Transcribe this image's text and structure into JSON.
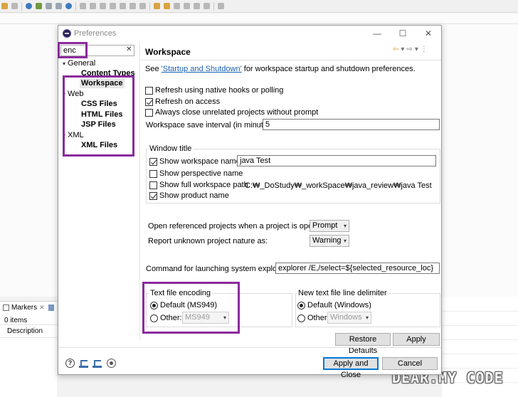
{
  "dialog": {
    "title": "Preferences",
    "minimize_glyph": "—",
    "maximize_glyph": "☐",
    "close_glyph": "✕"
  },
  "nav": {
    "search_value": "enc",
    "search_clear": "✕",
    "tree": {
      "general": "General",
      "content_types": "Content Types",
      "workspace": "Workspace",
      "web": "Web",
      "css_files": "CSS Files",
      "html_files": "HTML Files",
      "jsp_files": "JSP Files",
      "xml": "XML",
      "xml_files": "XML Files"
    }
  },
  "page": {
    "title": "Workspace",
    "desc_prefix": "See ",
    "desc_link": "'Startup and Shutdown'",
    "desc_suffix": " for workspace startup and shutdown preferences.",
    "refresh_native": "Refresh using native hooks or polling",
    "refresh_access": "Refresh on access",
    "always_close": "Always close unrelated projects without prompt",
    "save_interval_label": "Workspace save interval (in minutes):",
    "save_interval_value": "5",
    "window_title_group": "Window title",
    "show_ws_name": "Show workspace name:",
    "ws_name_value": "java Test",
    "show_perspective": "Show perspective name",
    "show_full_path": "Show full workspace path:",
    "full_path_value": "C:₩_DoStudy₩_workSpace₩java_review₩java Test",
    "show_product": "Show product name",
    "open_ref_label": "Open referenced projects when a project is opened:",
    "open_ref_value": "Prompt",
    "report_unknown_label": "Report unknown project nature as:",
    "report_unknown_value": "Warning",
    "cmd_label": "Command for launching system explorer:",
    "cmd_value": "explorer /E,/select=${selected_resource_loc}",
    "encoding_group": "Text file encoding",
    "enc_default": "Default (MS949)",
    "enc_other": "Other:",
    "enc_other_value": "MS949",
    "delim_group": "New text file line delimiter",
    "delim_default": "Default (Windows)",
    "delim_other": "Other:",
    "delim_other_value": "Windows",
    "restore_defaults": "Restore Defaults",
    "apply": "Apply",
    "apply_close": "Apply and Close",
    "cancel": "Cancel",
    "help_glyph": "?"
  },
  "ide": {
    "markers_tab": "Markers",
    "markers_close": "✕",
    "items_count": "0 items",
    "description_col": "Description"
  },
  "watermark": "DEAR.MY CODE",
  "colors": {
    "highlight": "#8b2a9c",
    "link": "#1a5fb4",
    "default_button_border": "#0078d7"
  },
  "icons": {
    "dropdown": "▾",
    "chevron_expanded": "▾",
    "nav_back": "⇦",
    "nav_forward": "⇨",
    "menu": "⋮"
  }
}
